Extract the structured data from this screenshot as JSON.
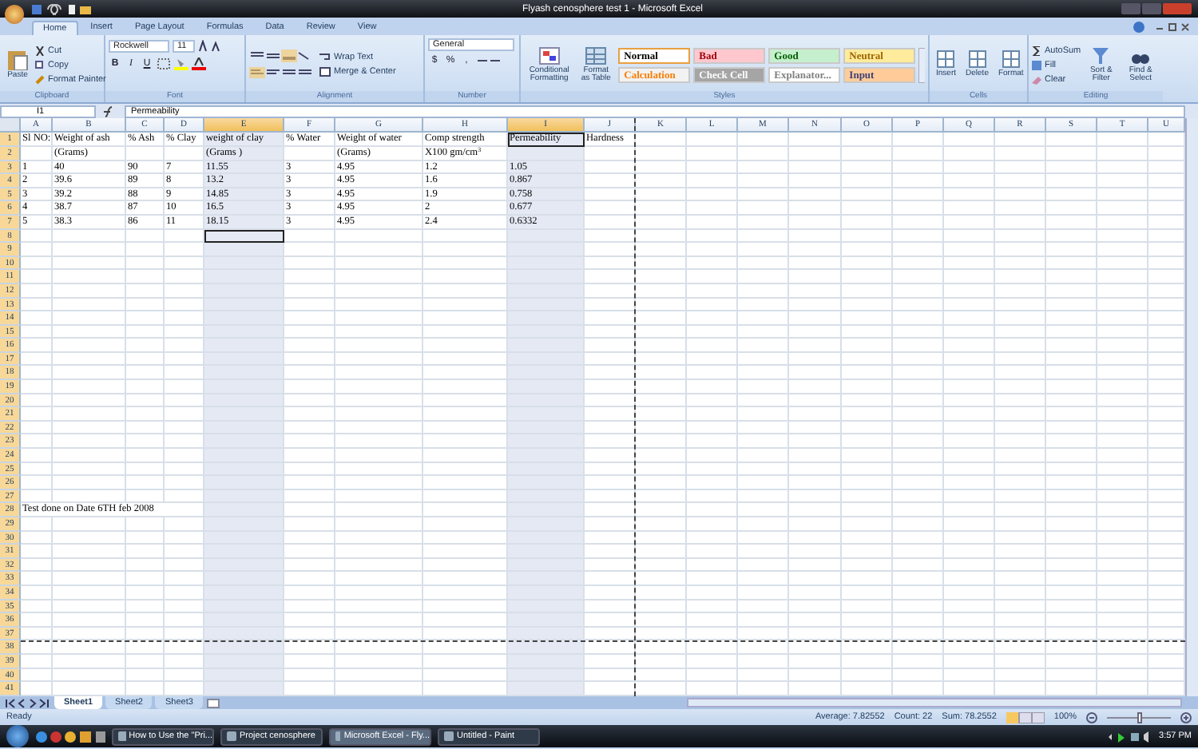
{
  "window": {
    "title": "Flyash cenosphere test 1 - Microsoft Excel"
  },
  "tabs": [
    {
      "label": "Home",
      "selected": true
    },
    {
      "label": "Insert",
      "selected": false
    },
    {
      "label": "Page Layout",
      "selected": false
    },
    {
      "label": "Formulas",
      "selected": false
    },
    {
      "label": "Data",
      "selected": false
    },
    {
      "label": "Review",
      "selected": false
    },
    {
      "label": "View",
      "selected": false
    }
  ],
  "ribbon": {
    "clipboard": {
      "label": "Clipboard",
      "paste": "Paste",
      "cut": "Cut",
      "copy": "Copy",
      "format_painter": "Format Painter"
    },
    "font": {
      "label": "Font",
      "name": "Rockwell",
      "size": "11",
      "bold": "B",
      "italic": "I",
      "underline": "U"
    },
    "alignment": {
      "label": "Alignment",
      "wrap_text": "Wrap Text",
      "merge_center": "Merge & Center"
    },
    "number": {
      "label": "Number",
      "format": "General",
      "currency": "$",
      "percent": "%",
      "comma": ","
    },
    "styles": {
      "label": "Styles",
      "conditional_formatting": "Conditional Formatting",
      "format_as_table": "Format as Table",
      "gallery": [
        {
          "label": "Normal",
          "kind": "normal",
          "color": "#ffffff",
          "selected": true
        },
        {
          "label": "Bad",
          "kind": "bad",
          "color": "#ffc7ce",
          "selected": false
        },
        {
          "label": "Good",
          "kind": "good",
          "color": "#c6efce",
          "selected": false
        },
        {
          "label": "Neutral",
          "kind": "neutral",
          "color": "#ffeb9c",
          "selected": false
        },
        {
          "label": "Calculation",
          "kind": "calculation",
          "color": "#f2f2f2",
          "selected": false
        },
        {
          "label": "Check Cell",
          "kind": "check",
          "color": "#a5a5a5",
          "selected": false
        },
        {
          "label": "Explanator...",
          "kind": "explanatory",
          "color": "#ffffff",
          "selected": false
        },
        {
          "label": "Input",
          "kind": "input",
          "color": "#ffcc99",
          "selected": false
        }
      ]
    },
    "cells": {
      "label": "Cells",
      "buttons": [
        "Insert",
        "Delete",
        "Format"
      ]
    },
    "editing": {
      "label": "Editing",
      "autosum": "AutoSum",
      "fill": "Fill",
      "clear": "Clear",
      "sort_filter": "Sort & Filter",
      "find_select": "Find & Select"
    }
  },
  "formula_bar": {
    "name_box": "I1",
    "formula": "Permeability"
  },
  "sheet": {
    "columns": [
      {
        "label": "A",
        "selected": false
      },
      {
        "label": "B",
        "selected": false
      },
      {
        "label": "C",
        "selected": false
      },
      {
        "label": "D",
        "selected": false
      },
      {
        "label": "E",
        "selected": true
      },
      {
        "label": "F",
        "selected": false
      },
      {
        "label": "G",
        "selected": false
      },
      {
        "label": "H",
        "selected": false
      },
      {
        "label": "I",
        "selected": true
      },
      {
        "label": "J",
        "selected": false,
        "page_break": true
      },
      {
        "label": "K",
        "selected": false
      },
      {
        "label": "L",
        "selected": false
      },
      {
        "label": "M",
        "selected": false
      },
      {
        "label": "N",
        "selected": false
      },
      {
        "label": "O",
        "selected": false
      },
      {
        "label": "P",
        "selected": false
      },
      {
        "label": "Q",
        "selected": false
      },
      {
        "label": "R",
        "selected": false
      },
      {
        "label": "S",
        "selected": false
      },
      {
        "label": "T",
        "selected": false
      },
      {
        "label": "U",
        "selected": false
      }
    ],
    "rows": [
      {
        "number": "1",
        "cells": [
          {
            "text": "Sl NO:"
          },
          {
            "text": "Weight of ash"
          },
          {
            "text": "% Ash"
          },
          {
            "text": "% Clay"
          },
          {
            "text": "weight of clay"
          },
          {
            "text": "% Water"
          },
          {
            "text": "Weight of water"
          },
          {
            "text": "Comp strength"
          },
          {
            "text": "Permeability",
            "outlined": true
          },
          {
            "text": "Hardness"
          }
        ]
      },
      {
        "number": "2",
        "cells": [
          {},
          {
            "text": "(Grams)"
          },
          {},
          {},
          {
            "text": "(Grams )"
          },
          {},
          {
            "text": "(Grams)"
          },
          {
            "text": "X100 gm/cm$^{3}$"
          }
        ]
      },
      {
        "number": "3",
        "cells": [
          {
            "text": "1"
          },
          {
            "text": "40"
          },
          {
            "text": "90"
          },
          {
            "text": "7"
          },
          {
            "text": "11.55"
          },
          {
            "text": "3"
          },
          {
            "text": "4.95"
          },
          {
            "text": "1.2"
          },
          {
            "text": "1.05"
          }
        ]
      },
      {
        "number": "4",
        "cells": [
          {
            "text": "2"
          },
          {
            "text": "39.6"
          },
          {
            "text": "89"
          },
          {
            "text": "8"
          },
          {
            "text": "13.2"
          },
          {
            "text": "3"
          },
          {
            "text": "4.95"
          },
          {
            "text": "1.6"
          },
          {
            "text": "0.867"
          }
        ]
      },
      {
        "number": "5",
        "cells": [
          {
            "text": "3"
          },
          {
            "text": "39.2"
          },
          {
            "text": "88"
          },
          {
            "text": "9"
          },
          {
            "text": "14.85"
          },
          {
            "text": "3"
          },
          {
            "text": "4.95"
          },
          {
            "text": "1.9"
          },
          {
            "text": "0.758"
          }
        ]
      },
      {
        "number": "6",
        "cells": [
          {
            "text": "4"
          },
          {
            "text": "38.7"
          },
          {
            "text": "87"
          },
          {
            "text": "10"
          },
          {
            "text": "16.5"
          },
          {
            "text": "3"
          },
          {
            "text": "4.95"
          },
          {
            "text": "2"
          },
          {
            "text": "0.677"
          }
        ]
      },
      {
        "number": "7",
        "cells": [
          {
            "text": "5"
          },
          {
            "text": "38.3"
          },
          {
            "text": "86"
          },
          {
            "text": "11"
          },
          {
            "text": "18.15"
          },
          {
            "text": "3"
          },
          {
            "text": "4.95"
          },
          {
            "text": "2.4"
          },
          {
            "text": "0.6332"
          }
        ]
      },
      {
        "number": "8",
        "cells": [
          {},
          {},
          {},
          {},
          {
            "outlined": true
          }
        ]
      },
      {
        "number": "9"
      },
      {
        "number": "10"
      },
      {
        "number": "11"
      },
      {
        "number": "12"
      },
      {
        "number": "13"
      },
      {
        "number": "14"
      },
      {
        "number": "15"
      },
      {
        "number": "16"
      },
      {
        "number": "17"
      },
      {
        "number": "18"
      },
      {
        "number": "19"
      },
      {
        "number": "20"
      },
      {
        "number": "21"
      },
      {
        "number": "22"
      },
      {
        "number": "23"
      },
      {
        "number": "24"
      },
      {
        "number": "25"
      },
      {
        "number": "26"
      },
      {
        "number": "27"
      },
      {
        "number": "28",
        "cells": [
          {
            "text": "Test done on Date 6TH feb 2008"
          }
        ]
      },
      {
        "number": "29"
      },
      {
        "number": "30"
      },
      {
        "number": "31"
      },
      {
        "number": "32"
      },
      {
        "number": "33"
      },
      {
        "number": "34"
      },
      {
        "number": "35"
      },
      {
        "number": "36"
      },
      {
        "number": "37",
        "page_break": true
      },
      {
        "number": "38"
      },
      {
        "number": "39"
      },
      {
        "number": "40"
      },
      {
        "number": "41"
      }
    ]
  },
  "sheet_tabs": [
    {
      "label": "Sheet1",
      "selected": true
    },
    {
      "label": "Sheet2",
      "selected": false
    },
    {
      "label": "Sheet3",
      "selected": false
    }
  ],
  "status_bar": {
    "mode": "Ready",
    "average": "Average: 7.82552",
    "count": "Count: 22",
    "sum": "Sum: 78.2552",
    "zoom": "100%",
    "zoom_slider": {
      "level": 0.5
    }
  },
  "taskbar": {
    "items": [
      {
        "label": "How to Use the \"Pri...",
        "selected": false
      },
      {
        "label": "Project cenosphere",
        "selected": false
      },
      {
        "label": "Microsoft Excel - Fly...",
        "selected": true
      },
      {
        "label": "Untitled - Paint",
        "selected": false
      }
    ],
    "clock": "3:57 PM"
  }
}
